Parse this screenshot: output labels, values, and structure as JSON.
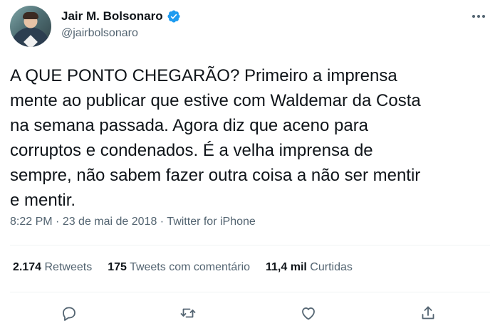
{
  "author": {
    "display_name": "Jair M. Bolsonaro",
    "handle": "@jairbolsonaro",
    "verified": true,
    "verified_color": "#1d9bf0"
  },
  "tweet": {
    "text": "A QUE PONTO CHEGARÃO? Primeiro a imprensa\nmente ao publicar que estive com Waldemar da Costa\nna semana passada. Agora diz que aceno para\ncorruptos e condenados. É a velha imprensa de\nsempre, não sabem fazer outra coisa a não ser mentir\ne mentir.",
    "time": "8:22 PM",
    "date": "23 de mai de 2018",
    "source": "Twitter for iPhone",
    "separator": " · "
  },
  "stats": {
    "retweets_count": "2.174",
    "retweets_label": "Retweets",
    "quotes_count": "175",
    "quotes_label": "Tweets com comentário",
    "likes_count": "11,4 mil",
    "likes_label": "Curtidas"
  },
  "actions": {
    "icons": [
      "reply-icon",
      "retweet-icon",
      "like-icon",
      "share-icon"
    ]
  },
  "colors": {
    "text": "#0f1419",
    "secondary": "#536471",
    "divider": "#eff3f4"
  }
}
